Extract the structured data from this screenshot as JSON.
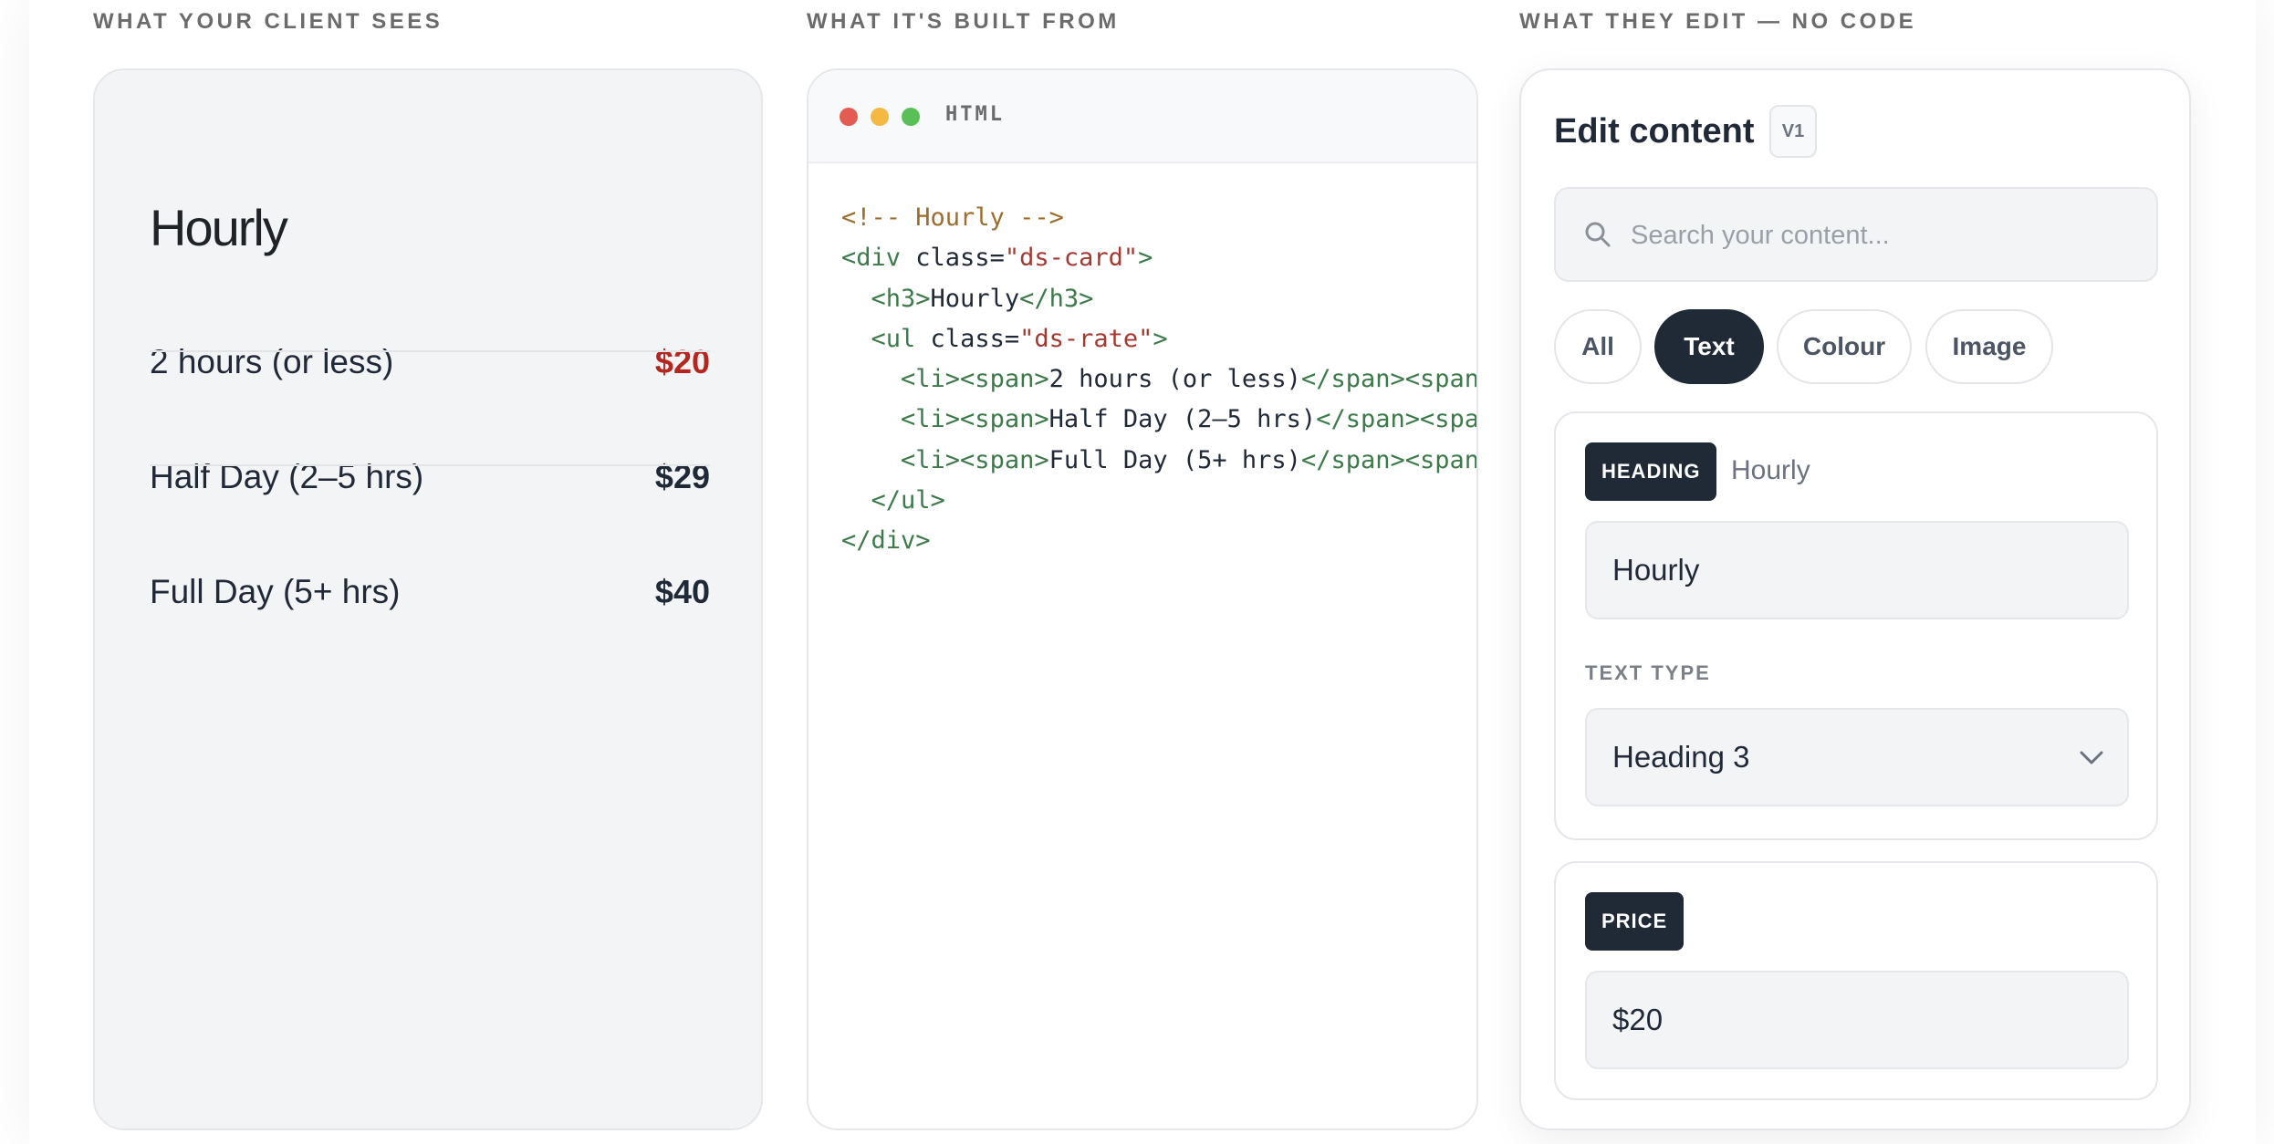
{
  "columns": {
    "preview_label": "WHAT YOUR CLIENT SEES",
    "code_label": "WHAT IT'S BUILT FROM",
    "editor_label": "WHAT THEY EDIT — NO CODE"
  },
  "preview": {
    "heading": "Hourly",
    "rates": [
      {
        "label": "2 hours (or less)",
        "price": "$20"
      },
      {
        "label": "Half Day (2–5 hrs)",
        "price": "$29"
      },
      {
        "label": "Full Day (5+ hrs)",
        "price": "$40"
      }
    ]
  },
  "code_window": {
    "language": "HTML",
    "lines": {
      "l1": "<!-- Hourly -->",
      "l2_open": "<div",
      "l2_attr": " class=",
      "l2_str": "\"ds-card\"",
      "l2_close": ">",
      "l3_open": "<h3>",
      "l3_text": "Hourly",
      "l3_close": "</h3>",
      "l4_open": "<ul",
      "l4_attr": " class=",
      "l4_str": "\"ds-rate\"",
      "l4_close": ">",
      "li1_open": "<li><span>",
      "li1_text": "2 hours (or less)",
      "li1_mid": "</span><span c",
      "li2_open": "<li><span>",
      "li2_text": "Half Day (2–5 hrs)",
      "li2_mid": "</span><span ",
      "li3_open": "<li><span>",
      "li3_text": "Full Day (5+ hrs)",
      "li3_mid": "</span><span c",
      "l8": "</ul>",
      "l9": "</div>"
    }
  },
  "editor": {
    "title": "Edit content",
    "version": "V1",
    "search_placeholder": "Search your content...",
    "filters": [
      "All",
      "Text",
      "Colour",
      "Image"
    ],
    "active_filter": "Text",
    "heading_section": {
      "tag": "HEADING",
      "meta": "Hourly",
      "value": "Hourly",
      "text_type_label": "TEXT TYPE",
      "text_type_value": "Heading 3"
    },
    "price_section": {
      "tag": "PRICE",
      "value": "$20"
    }
  },
  "colors": {
    "accent_price": "#b5261e",
    "dark_chip": "#1f2a36",
    "traffic_red": "#e25c54",
    "traffic_yellow": "#f4b942",
    "traffic_green": "#5bbf58"
  }
}
